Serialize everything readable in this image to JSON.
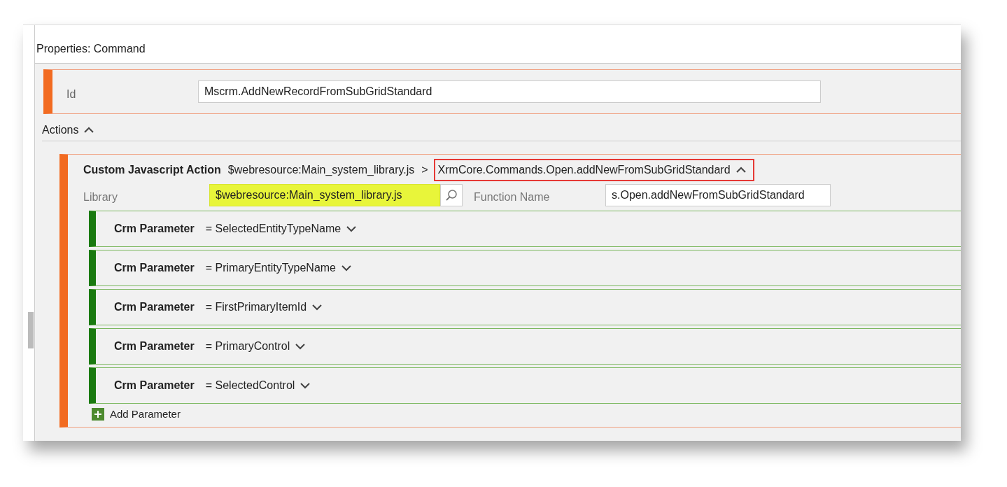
{
  "panel": {
    "title": "Properties: Command"
  },
  "id_field": {
    "label": "Id",
    "value": "Mscrm.AddNewRecordFromSubGridStandard"
  },
  "actions": {
    "label": "Actions",
    "expanded": true,
    "items": [
      {
        "title": "Custom Javascript Action",
        "library_path": "$webresource:Main_system_library.js",
        "separator": ">",
        "function_path": "XrmCore.Commands.Open.addNewFromSubGridStandard",
        "function_boxed": true,
        "expanded": true,
        "library": {
          "label": "Library",
          "value": "$webresource:Main_system_library.js",
          "highlighted": true
        },
        "function_name": {
          "label": "Function Name",
          "value": "s.Open.addNewFromSubGridStandard"
        },
        "parameters": [
          {
            "title": "Crm Parameter",
            "value": "= SelectedEntityTypeName",
            "expanded": false
          },
          {
            "title": "Crm Parameter",
            "value": "= PrimaryEntityTypeName",
            "expanded": false
          },
          {
            "title": "Crm Parameter",
            "value": "= FirstPrimaryItemId",
            "expanded": false
          },
          {
            "title": "Crm Parameter",
            "value": "= PrimaryControl",
            "expanded": false
          },
          {
            "title": "Crm Parameter",
            "value": "= SelectedControl",
            "expanded": false
          }
        ],
        "add_parameter": "Add Parameter"
      }
    ]
  }
}
